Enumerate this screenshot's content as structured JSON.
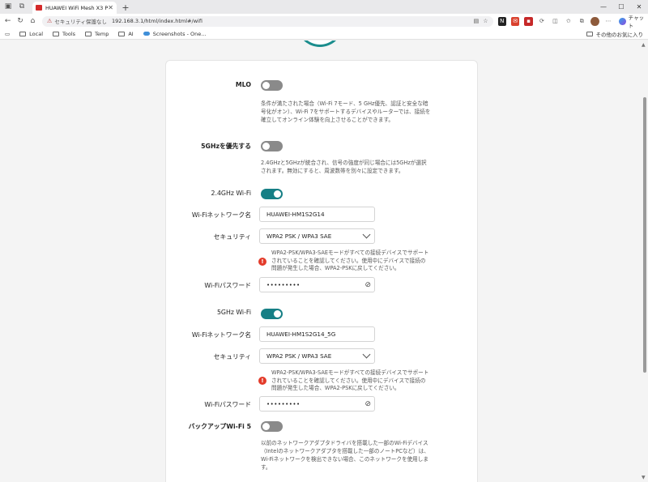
{
  "browser": {
    "tab_title": "HUAWEI WiFi Mesh X3 Pro",
    "tab_close": "✕",
    "new_tab": "+",
    "window_controls": [
      "—",
      "☐",
      "✕"
    ],
    "address": {
      "security_text": "セキュリティ保護なし",
      "url": "192.168.3.1/html/index.html#/wifi"
    },
    "chat_label": "チャット",
    "bookmarks": [
      "Local",
      "Tools",
      "Temp",
      "AI",
      "Screenshots - One..."
    ],
    "other_favorites": "その他のお気に入り"
  },
  "wifi": {
    "mlo": {
      "label": "MLO",
      "enabled": false,
      "description": "条件が満たされた場合（Wi-Fi 7モード、5 GHz優先、認証と安全な暗号化がオン）、Wi-Fi 7をサポートするデバイスやルーターでは、接続を確立してオンライン体験を向上させることができます。"
    },
    "prefer_5g": {
      "label": "5GHzを優先する",
      "enabled": false,
      "description": "2.4GHzと5GHzが統合され、信号の強度が同じ場合には5GHzが選択されます。無効にすると、周波数帯を別々に設定できます。"
    },
    "band_24": {
      "label": "2.4GHz Wi-Fi",
      "enabled": true,
      "ssid_label": "Wi-Fiネットワーク名",
      "ssid": "HUAWEI-HM1S2G14",
      "security_label": "セキュリティ",
      "security": "WPA2 PSK / WPA3 SAE",
      "warning": "WPA2-PSK/WPA3-SAEモードがすべての接続デバイスでサポートされていることを確認してください。使用中にデバイスで接続の問題が発生した場合、WPA2-PSKに戻してください。",
      "password_label": "Wi-Fiパスワード",
      "password_mask": "•••••••••"
    },
    "band_5": {
      "label": "5GHz Wi-Fi",
      "enabled": true,
      "ssid_label": "Wi-Fiネットワーク名",
      "ssid": "HUAWEI-HM1S2G14_5G",
      "security_label": "セキュリティ",
      "security": "WPA2 PSK / WPA3 SAE",
      "warning": "WPA2-PSK/WPA3-SAEモードがすべての接続デバイスでサポートされていることを確認してください。使用中にデバイスで接続の問題が発生した場合、WPA2-PSKに戻してください。",
      "password_label": "Wi-Fiパスワード",
      "password_mask": "•••••••••"
    },
    "backup_wifi5": {
      "label": "バックアップWi-Fi 5",
      "enabled": false,
      "description": "以前のネットワークアダプタドライバを搭載した一部のWi-Fiデバイス（Intelのネットワークアダプタを搭載した一部のノートPCなど）は、Wi-Fiネットワークを検出できない場合、このネットワークを使用します。"
    }
  },
  "colors": {
    "accent": "#167f85",
    "warning": "#e33b2a",
    "toggle_off": "#8a8a8a"
  }
}
